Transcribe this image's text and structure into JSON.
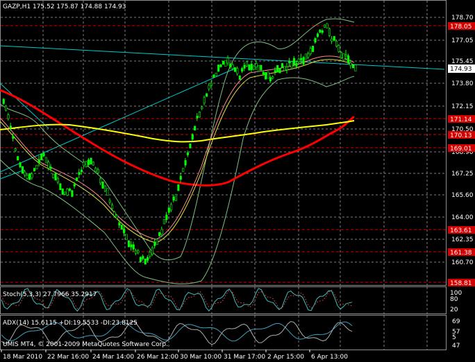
{
  "symbol_header": "GAZP,H1  175.52 175.87 174.88 174.93",
  "price_axis": [
    "178.70",
    "177.05",
    "175.45",
    "173.80",
    "172.15",
    "170.50",
    "168.90",
    "167.25",
    "165.60",
    "164.00",
    "162.35",
    "160.70"
  ],
  "red_levels": [
    "178.05",
    "171.14",
    "170.13",
    "169.01",
    "163.61",
    "161.38",
    "158.81"
  ],
  "current_price": "174.93",
  "time_axis": [
    "18 Mar 2010",
    "22 Mar 16:00",
    "24 Mar 14:00",
    "26 Mar 12:00",
    "30 Mar 10:00",
    "31 Mar 17:00",
    "2 Apr 15:00",
    "6 Apr 13:00"
  ],
  "stoch": {
    "label": "Stoch(5,3,3) 27.7966 35.2917",
    "axis": [
      "100",
      "80",
      "20"
    ]
  },
  "adx": {
    "label": "ADX(14) 15.6115 +DI:19.5533 -DI:23.8125",
    "axis": [
      "69",
      "57",
      "5",
      "47"
    ]
  },
  "copyright": "UMIS MT4, © 2001-2009 MetaQuotes Software Corp.",
  "colors": {
    "candle": "#00ff00",
    "ma_red": "#ff0000",
    "ma_yellow": "#ffff00",
    "line_cyan": "#00cccc",
    "grid": "#808080"
  }
}
